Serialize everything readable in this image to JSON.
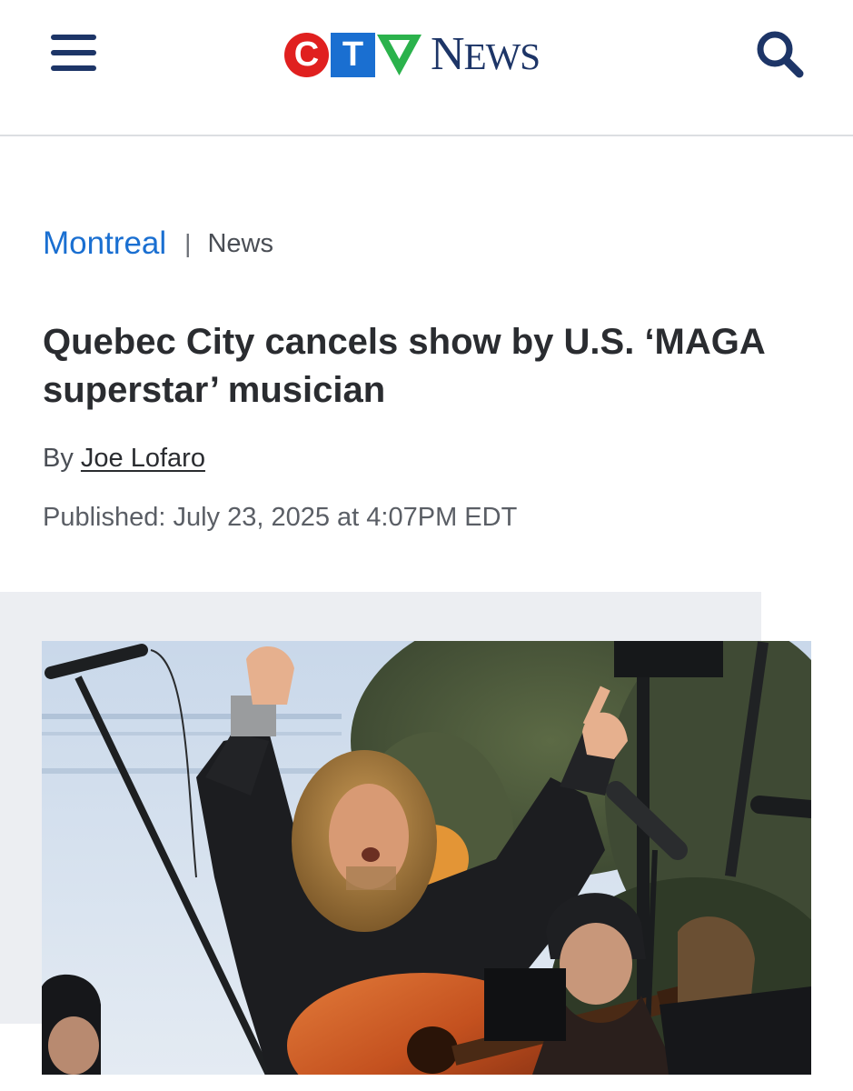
{
  "header": {
    "menu_icon": "hamburger-menu-icon",
    "logo": {
      "letters": [
        "C",
        "T",
        "V"
      ],
      "wordmark_initial": "N",
      "wordmark_rest": "EWS",
      "colors": {
        "c": "#e0201f",
        "t": "#1a6fd1",
        "v": "#2bb24c",
        "news": "#1d3567"
      }
    },
    "search_icon": "search-icon"
  },
  "article": {
    "section": "Montreal",
    "separator": "|",
    "category": "News",
    "title": "Quebec City cancels show by U.S. ‘MAGA superstar’ musician",
    "byline_prefix": "By",
    "author": "Joe Lofaro",
    "published": "Published: July 23, 2025 at 4:07PM EDT"
  },
  "photo": {
    "description_icon": "photo-musician-on-stage"
  },
  "colors": {
    "accent": "#1a6fd1",
    "brand_navy": "#1d3567",
    "title_text": "#2a2c30",
    "image_panel_bg": "#eceef2"
  }
}
